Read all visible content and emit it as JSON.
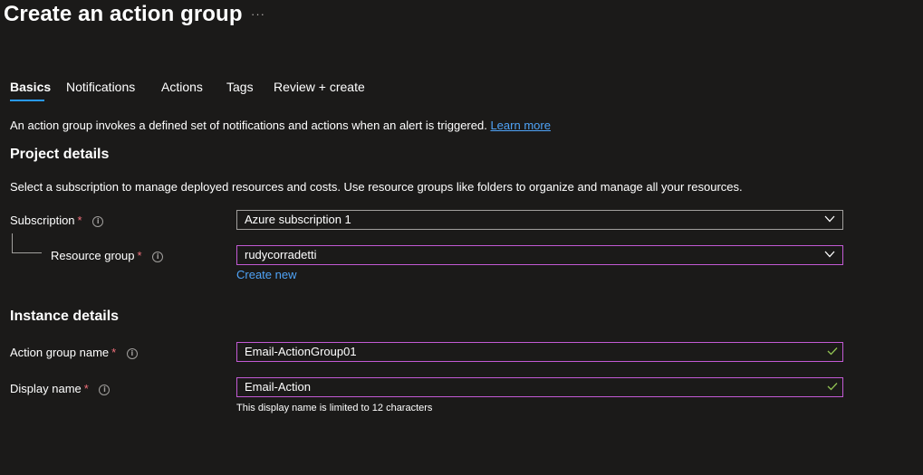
{
  "header": {
    "title": "Create an action group",
    "more_label": "···"
  },
  "tabs": [
    {
      "label": "Basics",
      "active": true
    },
    {
      "label": "Notifications",
      "active": false
    },
    {
      "label": "Actions",
      "active": false
    },
    {
      "label": "Tags",
      "active": false
    },
    {
      "label": "Review + create",
      "active": false
    }
  ],
  "intro": {
    "text": "An action group invokes a defined set of notifications and actions when an alert is triggered.",
    "learn_more": "Learn more"
  },
  "project_details": {
    "heading": "Project details",
    "description": "Select a subscription to manage deployed resources and costs. Use resource groups like folders to organize and manage all your resources.",
    "subscription": {
      "label": "Subscription",
      "required": "*",
      "value": "Azure subscription 1"
    },
    "resource_group": {
      "label": "Resource group",
      "required": "*",
      "value": "rudycorradetti",
      "create_new": "Create new"
    }
  },
  "instance_details": {
    "heading": "Instance details",
    "action_group_name": {
      "label": "Action group name",
      "required": "*",
      "value": "Email-ActionGroup01"
    },
    "display_name": {
      "label": "Display name",
      "required": "*",
      "value": "Email-Action",
      "hint": "This display name is limited to 12 characters"
    }
  },
  "icons": {
    "info": "info-icon",
    "dropdown": "chevron-down-icon",
    "valid": "checkmark-icon"
  },
  "colors": {
    "background": "#1b1a19",
    "accent": "#2899f5",
    "link": "#4fa3f7",
    "required": "#f1707b",
    "valid_border": "#c35ad5",
    "valid_check": "#92c353"
  }
}
